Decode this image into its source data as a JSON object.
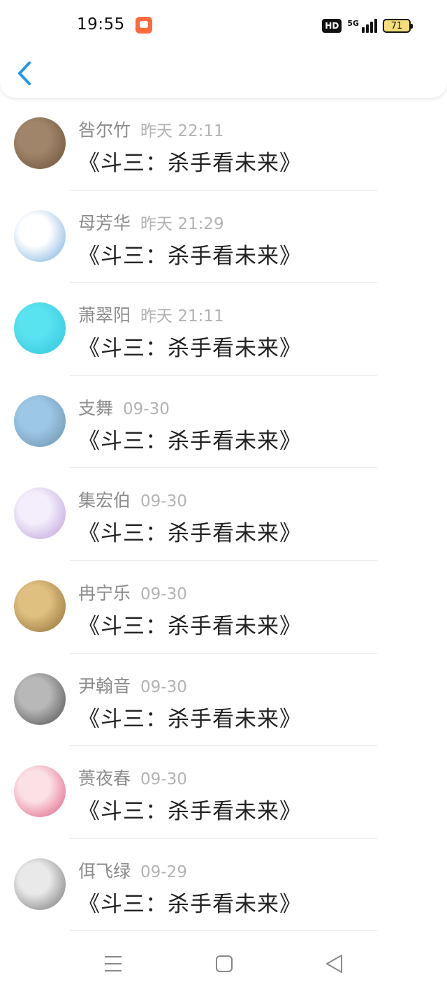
{
  "status_bar": {
    "time": "19:55",
    "network": "5G",
    "hd": "HD",
    "battery": "71"
  },
  "list": {
    "items": [
      {
        "name": "咎尔竹",
        "time": "昨天 22:11",
        "message": "《斗三：杀手看未来》",
        "avatar_colors": [
          "#a0856a",
          "#6b5038"
        ]
      },
      {
        "name": "母芳华",
        "time": "昨天 21:29",
        "message": "《斗三：杀手看未来》",
        "avatar_colors": [
          "#ffffff",
          "#6fa8dc"
        ]
      },
      {
        "name": "萧翠阳",
        "time": "昨天 21:11",
        "message": "《斗三：杀手看未来》",
        "avatar_colors": [
          "#59e2f0",
          "#2ec4da"
        ]
      },
      {
        "name": "支舞",
        "time": "09-30",
        "message": "《斗三：杀手看未来》",
        "avatar_colors": [
          "#9cc7e6",
          "#6a8fa9"
        ]
      },
      {
        "name": "集宏伯",
        "time": "09-30",
        "message": "《斗三：杀手看未来》",
        "avatar_colors": [
          "#f4eefc",
          "#b79ad6"
        ]
      },
      {
        "name": "冉宁乐",
        "time": "09-30",
        "message": "《斗三：杀手看未来》",
        "avatar_colors": [
          "#e0c080",
          "#8a6a30"
        ]
      },
      {
        "name": "尹翰音",
        "time": "09-30",
        "message": "《斗三：杀手看未来》",
        "avatar_colors": [
          "#b8b8b8",
          "#4a4a4a"
        ]
      },
      {
        "name": "蒉夜春",
        "time": "09-30",
        "message": "《斗三：杀手看未来》",
        "avatar_colors": [
          "#fbe1e6",
          "#e0567c"
        ]
      },
      {
        "name": "佴飞绿",
        "time": "09-29",
        "message": "《斗三：杀手看未来》",
        "avatar_colors": [
          "#e9e9e9",
          "#6e6e6e"
        ]
      }
    ]
  },
  "colors": {
    "accent": "#2196f3",
    "name_gray": "#8c8c8c",
    "time_gray": "#b3b3b3",
    "message_text": "#222222"
  }
}
